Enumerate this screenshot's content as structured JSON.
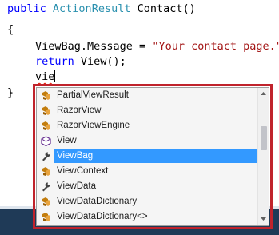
{
  "code": {
    "line1": {
      "kw": "public",
      "type": "ActionResult",
      "rest": " Contact()"
    },
    "line2": "{",
    "line3": {
      "obj": "ViewBag.Message = ",
      "str": "\"Your contact page.\"",
      "tail": ";"
    },
    "line4": {
      "kw": "return",
      "rest": " View();"
    },
    "line5": {
      "typed": "vie"
    },
    "line6": "}"
  },
  "completion": {
    "selected_index": 4,
    "items": [
      {
        "label": "PartialViewResult",
        "icon": "class-icon"
      },
      {
        "label": "RazorView",
        "icon": "class-icon"
      },
      {
        "label": "RazorViewEngine",
        "icon": "class-icon"
      },
      {
        "label": "View",
        "icon": "method-icon"
      },
      {
        "label": "ViewBag",
        "icon": "property-icon"
      },
      {
        "label": "ViewContext",
        "icon": "class-icon"
      },
      {
        "label": "ViewData",
        "icon": "property-icon"
      },
      {
        "label": "ViewDataDictionary",
        "icon": "class-icon"
      },
      {
        "label": "ViewDataDictionary<>",
        "icon": "class-icon"
      }
    ]
  },
  "colors": {
    "keyword": "#0000ff",
    "type": "#2b91af",
    "string": "#a31515",
    "selection": "#3399ff",
    "highlight_frame": "#c0232c"
  }
}
